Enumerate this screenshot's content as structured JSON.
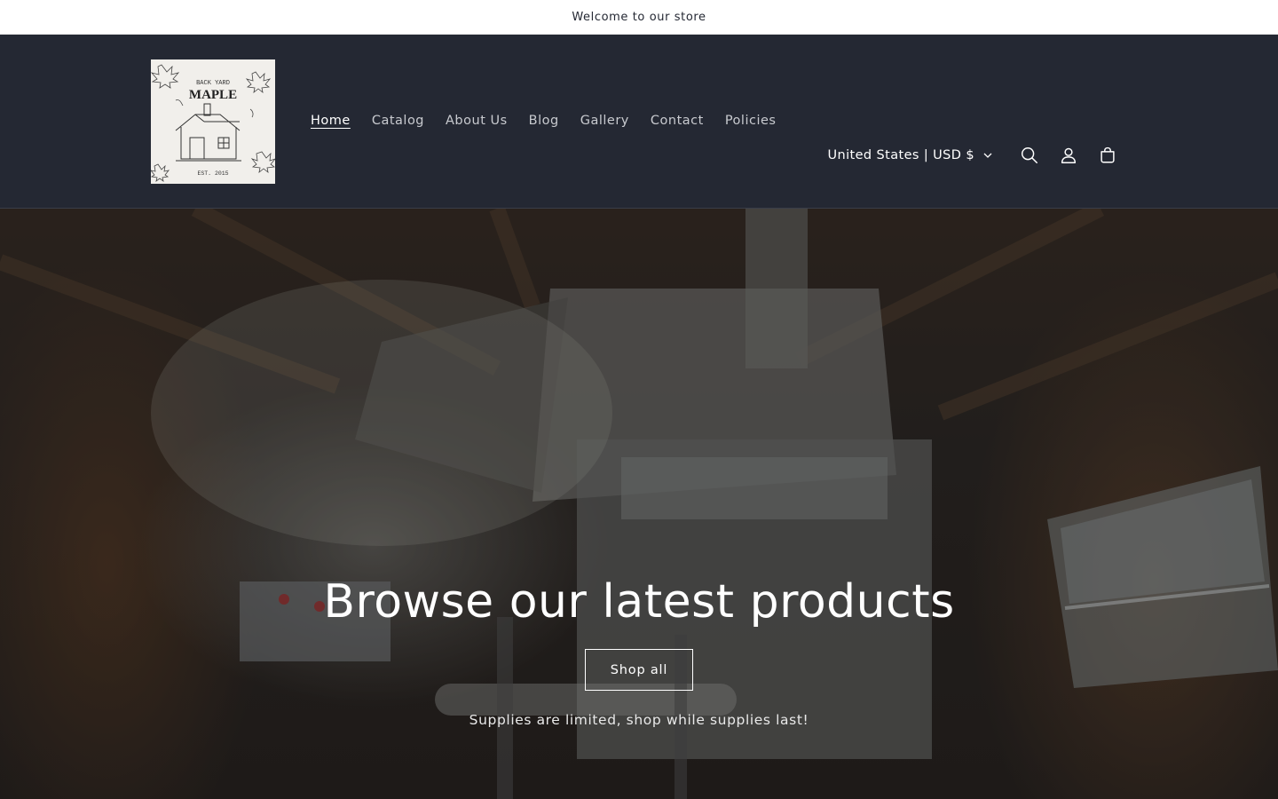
{
  "announcement": {
    "text": "Welcome to our store"
  },
  "logo": {
    "line1": "BACK YARD",
    "line2": "MAPLE",
    "est": "EST. 2015"
  },
  "nav": {
    "items": [
      {
        "label": "Home",
        "active": true
      },
      {
        "label": "Catalog"
      },
      {
        "label": "About Us"
      },
      {
        "label": "Blog"
      },
      {
        "label": "Gallery"
      },
      {
        "label": "Contact"
      },
      {
        "label": "Policies"
      }
    ]
  },
  "header": {
    "currency_label": "United States | USD $",
    "icons": [
      "search-icon",
      "account-icon",
      "cart-icon"
    ]
  },
  "hero": {
    "title": "Browse our latest products",
    "button_label": "Shop all",
    "subtitle": "Supplies are limited, shop while supplies last!"
  },
  "colors": {
    "header_bg": "#242833",
    "announcement_bg": "#ffffff",
    "text_light": "#ffffff",
    "nav_text": "#c8cacf"
  }
}
